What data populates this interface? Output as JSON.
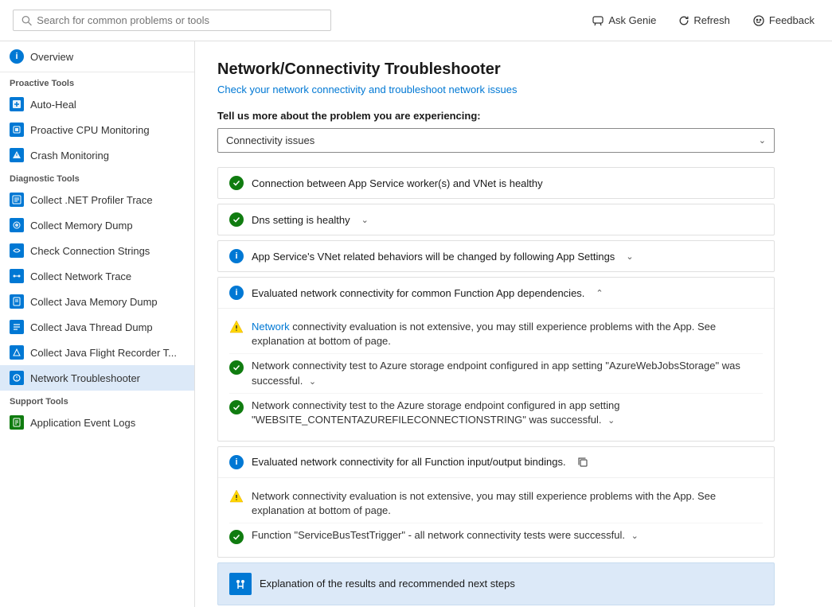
{
  "topbar": {
    "search_placeholder": "Search for common problems or tools",
    "ask_genie_label": "Ask Genie",
    "refresh_label": "Refresh",
    "feedback_label": "Feedback"
  },
  "sidebar": {
    "overview_label": "Overview",
    "proactive_tools_label": "Proactive Tools",
    "diagnostic_tools_label": "Diagnostic Tools",
    "support_tools_label": "Support Tools",
    "proactive_items": [
      {
        "id": "auto-heal",
        "label": "Auto-Heal"
      },
      {
        "id": "proactive-cpu",
        "label": "Proactive CPU Monitoring"
      },
      {
        "id": "crash-monitoring",
        "label": "Crash Monitoring"
      }
    ],
    "diagnostic_items": [
      {
        "id": "net-profiler",
        "label": "Collect .NET Profiler Trace"
      },
      {
        "id": "memory-dump",
        "label": "Collect Memory Dump"
      },
      {
        "id": "connection-strings",
        "label": "Check Connection Strings"
      },
      {
        "id": "network-trace",
        "label": "Collect Network Trace"
      },
      {
        "id": "java-memory-dump",
        "label": "Collect Java Memory Dump"
      },
      {
        "id": "java-thread-dump",
        "label": "Collect Java Thread Dump"
      },
      {
        "id": "java-flight-recorder",
        "label": "Collect Java Flight Recorder T..."
      },
      {
        "id": "network-troubleshooter",
        "label": "Network Troubleshooter",
        "active": true
      }
    ],
    "support_items": [
      {
        "id": "app-event-logs",
        "label": "Application Event Logs",
        "iconColor": "green"
      }
    ]
  },
  "content": {
    "title": "Network/Connectivity Troubleshooter",
    "subtitle": "Check your network connectivity and troubleshoot network issues",
    "problem_label": "Tell us more about the problem you are experiencing:",
    "dropdown_value": "Connectivity issues",
    "results": [
      {
        "id": "vnet-health",
        "type": "success",
        "text": "Connection between App Service worker(s) and VNet is healthy",
        "expandable": false
      },
      {
        "id": "dns-health",
        "type": "success",
        "text": "Dns setting is healthy",
        "expandable": true,
        "expand_direction": "down"
      },
      {
        "id": "vnet-behaviors",
        "type": "info",
        "text": "App Service's VNet related behaviors will be changed by following App Settings",
        "expandable": true,
        "expand_direction": "down"
      },
      {
        "id": "function-dependencies",
        "type": "info",
        "text": "Evaluated network connectivity for common Function App dependencies.",
        "expandable": true,
        "expand_direction": "up",
        "expanded": true,
        "sub_items": [
          {
            "type": "warning",
            "text": "Network connectivity evaluation is not extensive, you may still experience problems with the App. See explanation at bottom of page."
          },
          {
            "type": "success",
            "text": "Network connectivity test to Azure storage endpoint configured in app setting \"AzureWebJobsStorage\" was successful.",
            "expandable": true
          },
          {
            "type": "success",
            "text": "Network connectivity test to the Azure storage endpoint configured in app setting \"WEBSITE_CONTENTAZUREFILECONNECTIONSTRING\" was successful.",
            "expandable": true
          }
        ]
      },
      {
        "id": "function-bindings",
        "type": "info",
        "text": "Evaluated network connectivity for all Function input/output bindings.",
        "expandable": false,
        "has_copy_icon": true,
        "expanded": true,
        "sub_items": [
          {
            "type": "warning",
            "text": "Network connectivity evaluation is not extensive, you may still experience problems with the App. See explanation at bottom of page."
          },
          {
            "type": "success",
            "text": "Function \"ServiceBusTestTrigger\" - all network connectivity tests were successful.",
            "expandable": true
          }
        ]
      }
    ],
    "explanation_bar": {
      "text": "Explanation of the results and recommended next steps"
    }
  }
}
